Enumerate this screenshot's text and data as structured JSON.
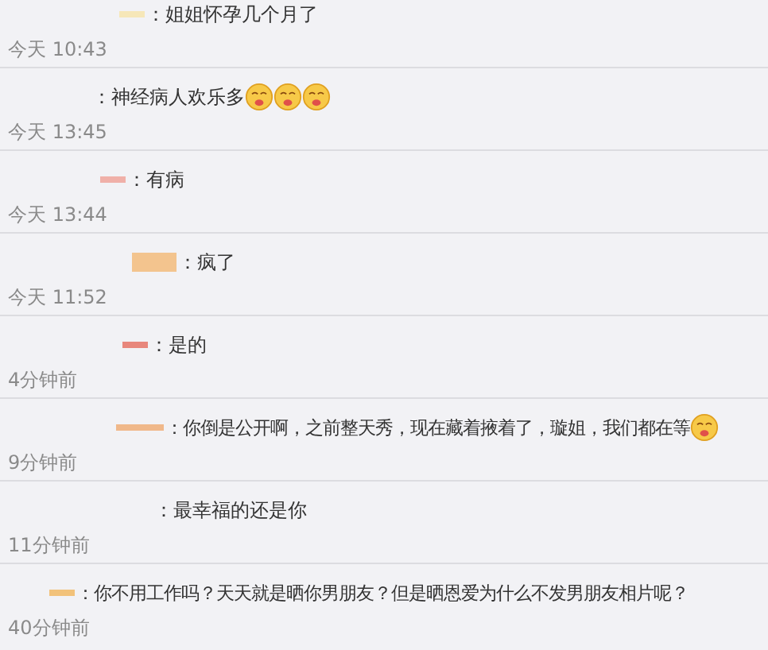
{
  "comments": [
    {
      "mask": {
        "color": "#f6e7b8"
      },
      "parts": [
        {
          "kind": "text",
          "text": "：姐姐怀孕几个月了"
        }
      ],
      "time": "今天 10:43"
    },
    {
      "parts": [
        {
          "kind": "text",
          "text": "：神经病人欢乐多"
        },
        {
          "kind": "emoji"
        },
        {
          "kind": "emoji"
        },
        {
          "kind": "emoji"
        }
      ],
      "time": "今天 13:45"
    },
    {
      "mask": {
        "color": "#f0b0a8"
      },
      "parts": [
        {
          "kind": "text",
          "text": "：有病"
        }
      ],
      "time": "今天 13:44"
    },
    {
      "mask": {
        "color": "#f3c48e"
      },
      "parts": [
        {
          "kind": "text",
          "text": "：疯了"
        }
      ],
      "time": "今天 11:52"
    },
    {
      "mask": {
        "color": "#e8877c"
      },
      "parts": [
        {
          "kind": "text",
          "text": "：是的"
        }
      ],
      "time": "4分钟前"
    },
    {
      "mask": {
        "color": "#f0b88a"
      },
      "parts": [
        {
          "kind": "text",
          "text": "：你倒是公开啊，之前整天秀，现在藏着掖着了，璇姐，我们都在等"
        },
        {
          "kind": "emoji"
        }
      ],
      "time": "9分钟前"
    },
    {
      "parts": [
        {
          "kind": "text",
          "text": "：最幸福的还是你"
        }
      ],
      "time": "11分钟前"
    },
    {
      "mask": {
        "color": "#f2c27a"
      },
      "parts": [
        {
          "kind": "text",
          "text": "：你不用工作吗？天天就是晒你男朋友？但是晒恩爱为什么不发男朋友相片呢？"
        }
      ],
      "time": "40分钟前"
    }
  ]
}
